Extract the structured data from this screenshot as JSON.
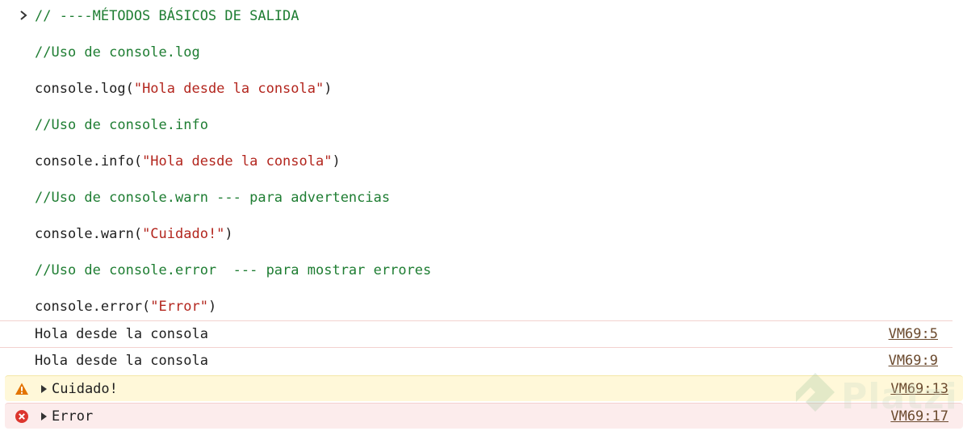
{
  "input": {
    "lines": [
      [
        {
          "t": "// ----MÉTODOS BÁSICOS DE SALIDA",
          "c": "comment"
        }
      ],
      [
        {
          "t": "//Uso de console.log",
          "c": "comment"
        }
      ],
      [
        {
          "t": "console.log(",
          "c": "plain"
        },
        {
          "t": "\"Hola desde la consola\"",
          "c": "str"
        },
        {
          "t": ")",
          "c": "plain"
        }
      ],
      [
        {
          "t": "//Uso de console.info",
          "c": "comment"
        }
      ],
      [
        {
          "t": "console.info(",
          "c": "plain"
        },
        {
          "t": "\"Hola desde la consola\"",
          "c": "str"
        },
        {
          "t": ")",
          "c": "plain"
        }
      ],
      [
        {
          "t": "//Uso de console.warn --- para advertencias",
          "c": "comment"
        }
      ],
      [
        {
          "t": "console.warn(",
          "c": "plain"
        },
        {
          "t": "\"Cuidado!\"",
          "c": "str"
        },
        {
          "t": ")",
          "c": "plain"
        }
      ],
      [
        {
          "t": "//Uso de console.error  --- para mostrar errores",
          "c": "comment"
        }
      ],
      [
        {
          "t": "console.error(",
          "c": "plain"
        },
        {
          "t": "\"Error\"",
          "c": "str"
        },
        {
          "t": ")",
          "c": "plain"
        }
      ]
    ]
  },
  "output": {
    "log1": {
      "text": "Hola desde la consola",
      "source": "VM69:5"
    },
    "log2": {
      "text": "Hola desde la consola",
      "source": "VM69:9"
    },
    "warn": {
      "text": "Cuidado!",
      "source": "VM69:13",
      "icon": "warning-icon"
    },
    "error": {
      "text": "Error",
      "source": "VM69:17",
      "icon": "error-icon"
    }
  },
  "watermark": {
    "text": "Platzi"
  },
  "colors": {
    "comment": "#1e7d32",
    "string": "#b3261e",
    "warn_bg": "#fff8d9",
    "error_bg": "#fcecec",
    "warn_icon": "#e37400",
    "error_icon": "#dc362e"
  }
}
